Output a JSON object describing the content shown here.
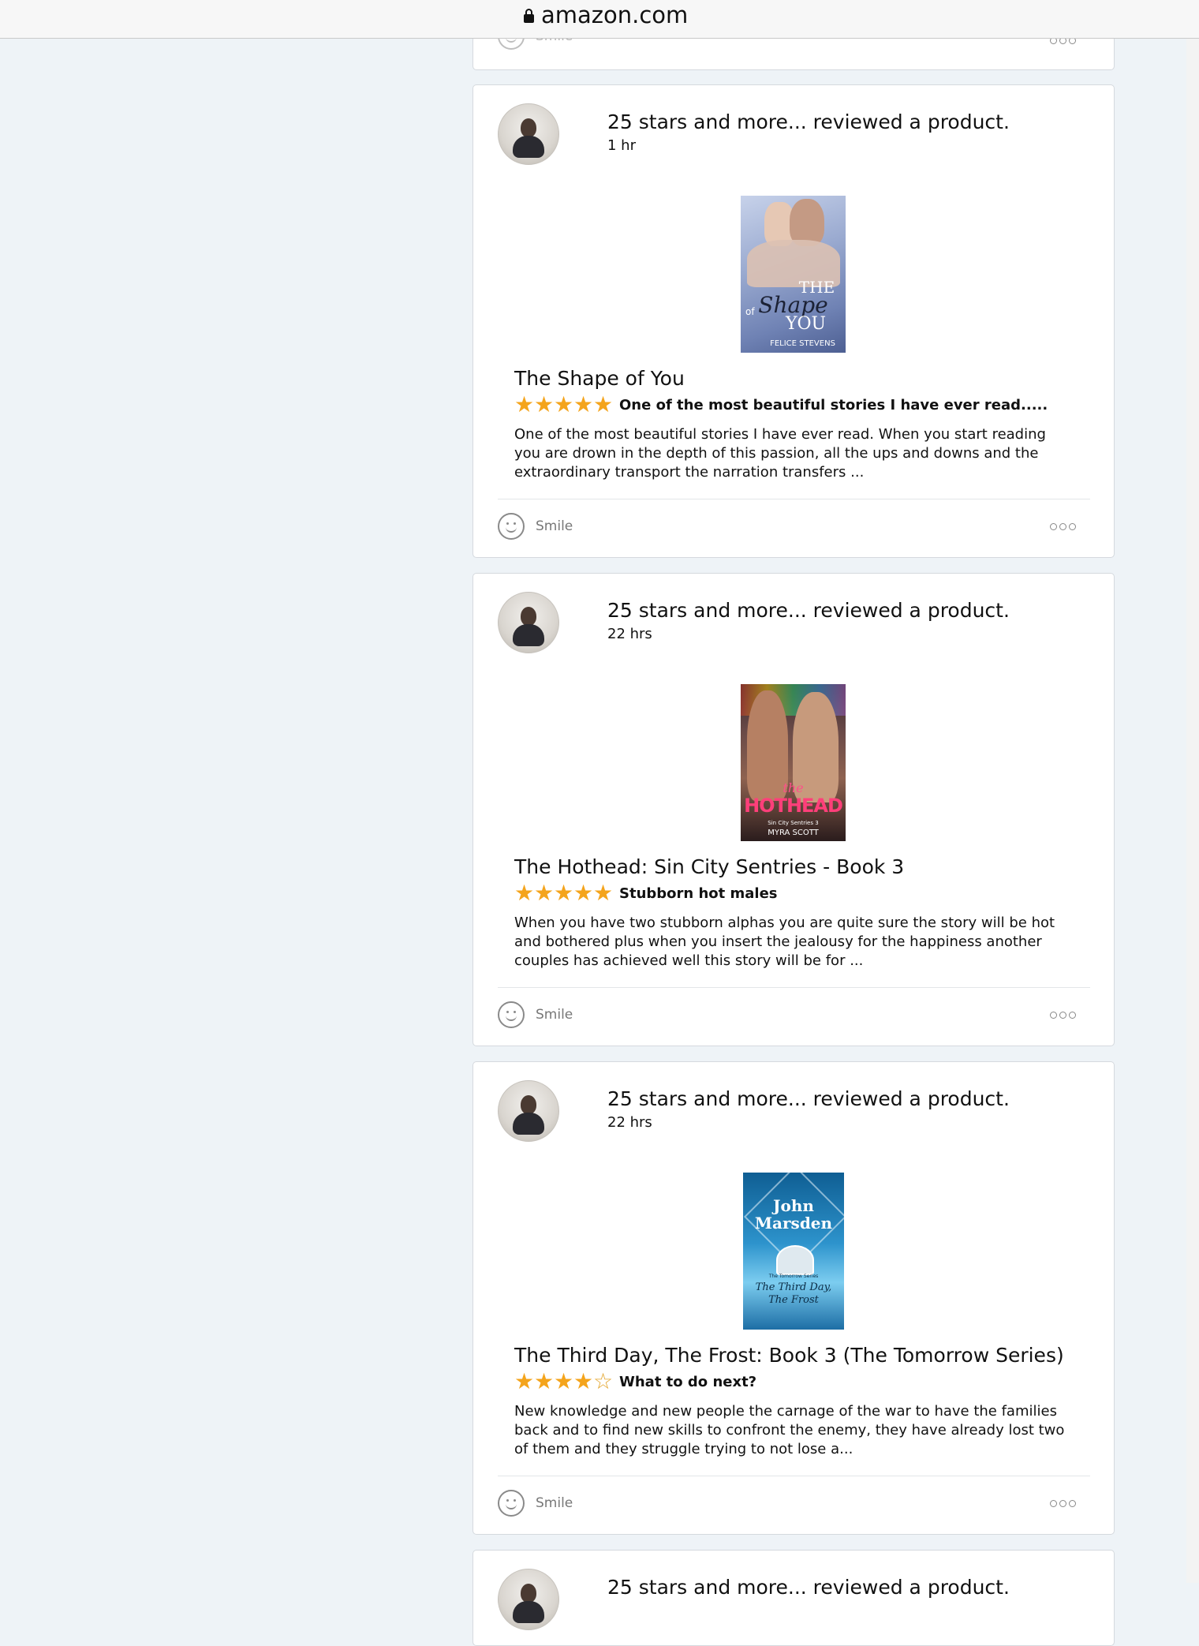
{
  "browser": {
    "url": "amazon.com"
  },
  "cards": [
    {
      "actor": "25 stars and more... reviewed a product.",
      "time": "1 hr",
      "product_title": "The Shape of You",
      "rating": 5,
      "headline": "One of the most beautiful stories I have ever read.....",
      "body": "One of the most beautiful stories I have ever read. When you start reading you are drown in the depth of this passion, all the ups and downs and the extraordinary transport the narration transfers ...",
      "cover": {
        "title_line1": "THE",
        "title_line2": "Shape",
        "title_line3": "YOU",
        "small_of": "of",
        "author": "FELICE STEVENS",
        "colors": [
          "#5a6e9a",
          "#9fb1d6"
        ]
      },
      "smile_label": "Smile"
    },
    {
      "actor": "25 stars and more... reviewed a product.",
      "time": "22 hrs",
      "product_title": "The Hothead: Sin City Sentries - Book 3",
      "rating": 5,
      "headline": "Stubborn hot males",
      "body": "When you have two stubborn alphas you are quite sure the story will be hot and bothered plus when you insert the jealousy for the happiness another couples has achieved well this story will be for ...",
      "cover": {
        "title_small": "the",
        "title_big": "HOTHEAD",
        "series": "Sin City Sentries 3",
        "author": "MYRA SCOTT",
        "colors": [
          "#2b1a1a",
          "#a06a55"
        ]
      },
      "smile_label": "Smile"
    },
    {
      "actor": "25 stars and more... reviewed a product.",
      "time": "22 hrs",
      "product_title": "The Third Day, The Frost: Book 3 (The Tomorrow Series)",
      "rating": 4,
      "headline": "What to do next?",
      "body": "New knowledge and new people the carnage of the war to have the families back and to find new skills to confront the enemy, they have already lost two of them and they struggle trying to not lose a...",
      "cover": {
        "author_line1": "John",
        "author_line2": "Marsden",
        "series_small": "The Tomorrow Series",
        "title_line1": "The Third Day,",
        "title_line2": "The Frost",
        "colors": [
          "#1b78b8",
          "#7fd0f0"
        ]
      },
      "smile_label": "Smile"
    }
  ],
  "top_partial_card": {
    "smile_label": "Smile"
  },
  "bottom_partial_card": {
    "actor": "25 stars and more... reviewed a product."
  },
  "theme": {
    "star_color": "#f4a41c",
    "card_border": "#d5d9de",
    "page_bg": "#eef3f7"
  }
}
